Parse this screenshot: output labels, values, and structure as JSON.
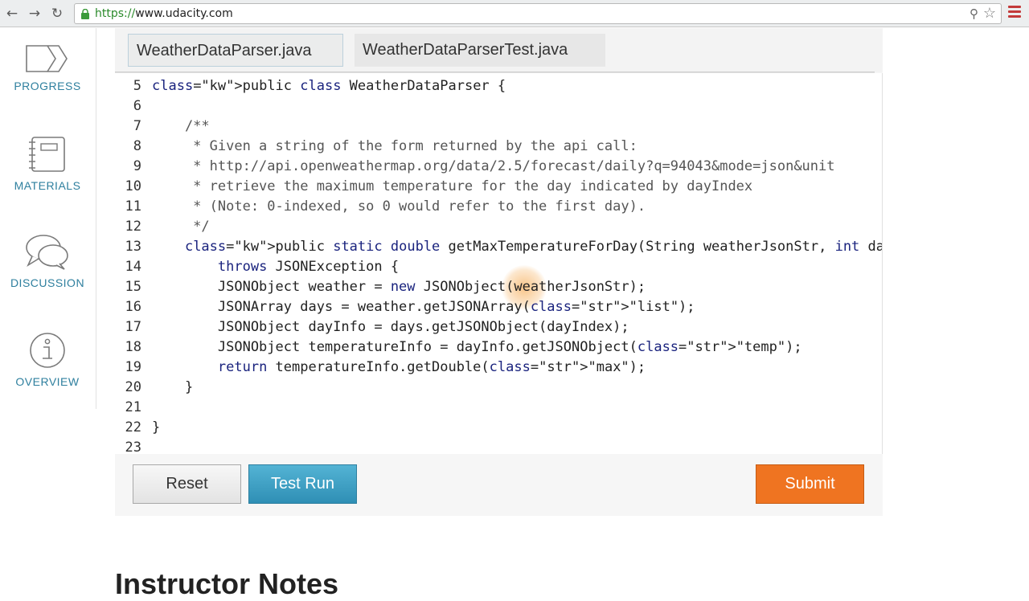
{
  "browser": {
    "url_scheme": "https://",
    "url_host": "www.udacity.com"
  },
  "sidebar": {
    "items": [
      {
        "label": "PROGRESS",
        "icon": "progress-icon"
      },
      {
        "label": "MATERIALS",
        "icon": "notebook-icon"
      },
      {
        "label": "DISCUSSION",
        "icon": "chat-bubbles-icon"
      },
      {
        "label": "OVERVIEW",
        "icon": "info-icon"
      }
    ]
  },
  "editor": {
    "tabs": [
      {
        "label": "WeatherDataParser.java",
        "active": true
      },
      {
        "label": "WeatherDataParserTest.java",
        "active": false
      }
    ],
    "lines": [
      {
        "num": "5",
        "text": "public class WeatherDataParser {"
      },
      {
        "num": "6",
        "text": ""
      },
      {
        "num": "7",
        "text": "    /**"
      },
      {
        "num": "8",
        "text": "     * Given a string of the form returned by the api call:"
      },
      {
        "num": "9",
        "text": "     * http://api.openweathermap.org/data/2.5/forecast/daily?q=94043&mode=json&unit"
      },
      {
        "num": "10",
        "text": "     * retrieve the maximum temperature for the day indicated by dayIndex"
      },
      {
        "num": "11",
        "text": "     * (Note: 0-indexed, so 0 would refer to the first day)."
      },
      {
        "num": "12",
        "text": "     */"
      },
      {
        "num": "13",
        "text": "    public static double getMaxTemperatureForDay(String weatherJsonStr, int dayIr"
      },
      {
        "num": "14",
        "text": "        throws JSONException {"
      },
      {
        "num": "15",
        "text": "        JSONObject weather = new JSONObject(weatherJsonStr);"
      },
      {
        "num": "16",
        "text": "        JSONArray days = weather.getJSONArray(\"list\");"
      },
      {
        "num": "17",
        "text": "        JSONObject dayInfo = days.getJSONObject(dayIndex);"
      },
      {
        "num": "18",
        "text": "        JSONObject temperatureInfo = dayInfo.getJSONObject(\"temp\");"
      },
      {
        "num": "19",
        "text": "        return temperatureInfo.getDouble(\"max\");"
      },
      {
        "num": "20",
        "text": "    }"
      },
      {
        "num": "21",
        "text": ""
      },
      {
        "num": "22",
        "text": "}"
      },
      {
        "num": "23",
        "text": ""
      }
    ]
  },
  "buttons": {
    "reset": "Reset",
    "test_run": "Test Run",
    "submit": "Submit"
  },
  "footer": {
    "heading": "Instructor Notes"
  },
  "colors": {
    "accent": "#2e7f9e",
    "submit": "#ef7421",
    "test_run": "#3a9ec3"
  }
}
